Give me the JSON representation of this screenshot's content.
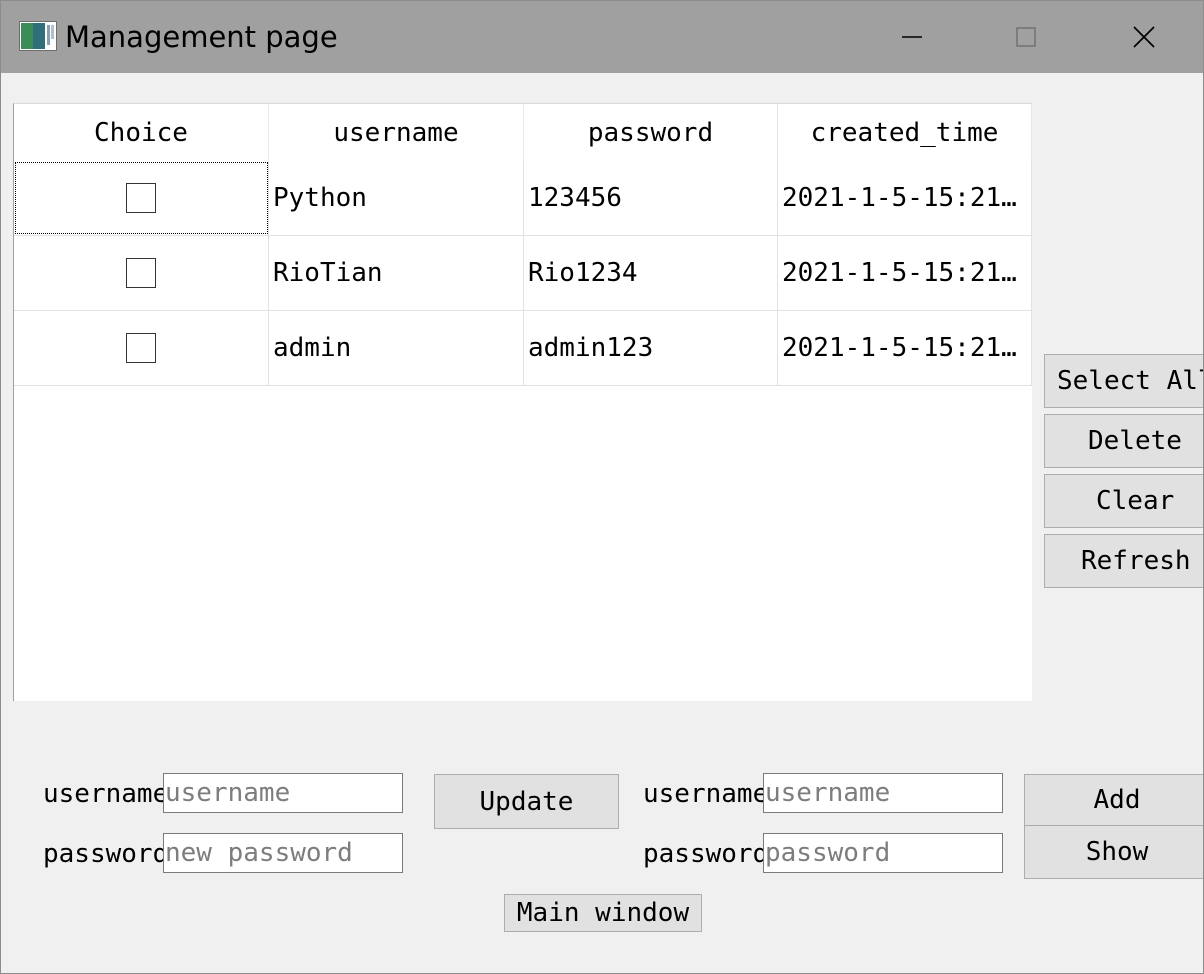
{
  "window": {
    "title": "Management page",
    "app_icon": "app-window-icon",
    "controls": {
      "minimize_icon": "minimize-icon",
      "maximize_icon": "maximize-icon",
      "close_icon": "close-icon"
    }
  },
  "table": {
    "columns": [
      "Choice",
      "username",
      "password",
      "created_time"
    ],
    "rows": [
      {
        "username": "Python",
        "password": "123456",
        "created_time": "2021-1-5-15:21…",
        "checked": false
      },
      {
        "username": "RioTian",
        "password": "Rio1234",
        "created_time": "2021-1-5-15:21…",
        "checked": false
      },
      {
        "username": "admin",
        "password": "admin123",
        "created_time": "2021-1-5-15:21…",
        "checked": false
      }
    ]
  },
  "side_buttons": {
    "select_all": "Select All",
    "delete": "Delete",
    "clear": "Clear",
    "refresh": "Refresh"
  },
  "update_form": {
    "username_label": "username",
    "username_placeholder": "username",
    "password_label": "password",
    "password_placeholder": "new password",
    "update_button": "Update"
  },
  "add_form": {
    "username_label": "username",
    "username_placeholder": "username",
    "password_label": "password",
    "password_placeholder": "password",
    "add_button": "Add",
    "show_button": "Show"
  },
  "main_window_button": "Main window",
  "colors": {
    "titlebar": "#a0a0a0",
    "window_bg": "#f0f0f0",
    "button_bg": "#e1e1e1",
    "table_bg": "#ffffff"
  }
}
